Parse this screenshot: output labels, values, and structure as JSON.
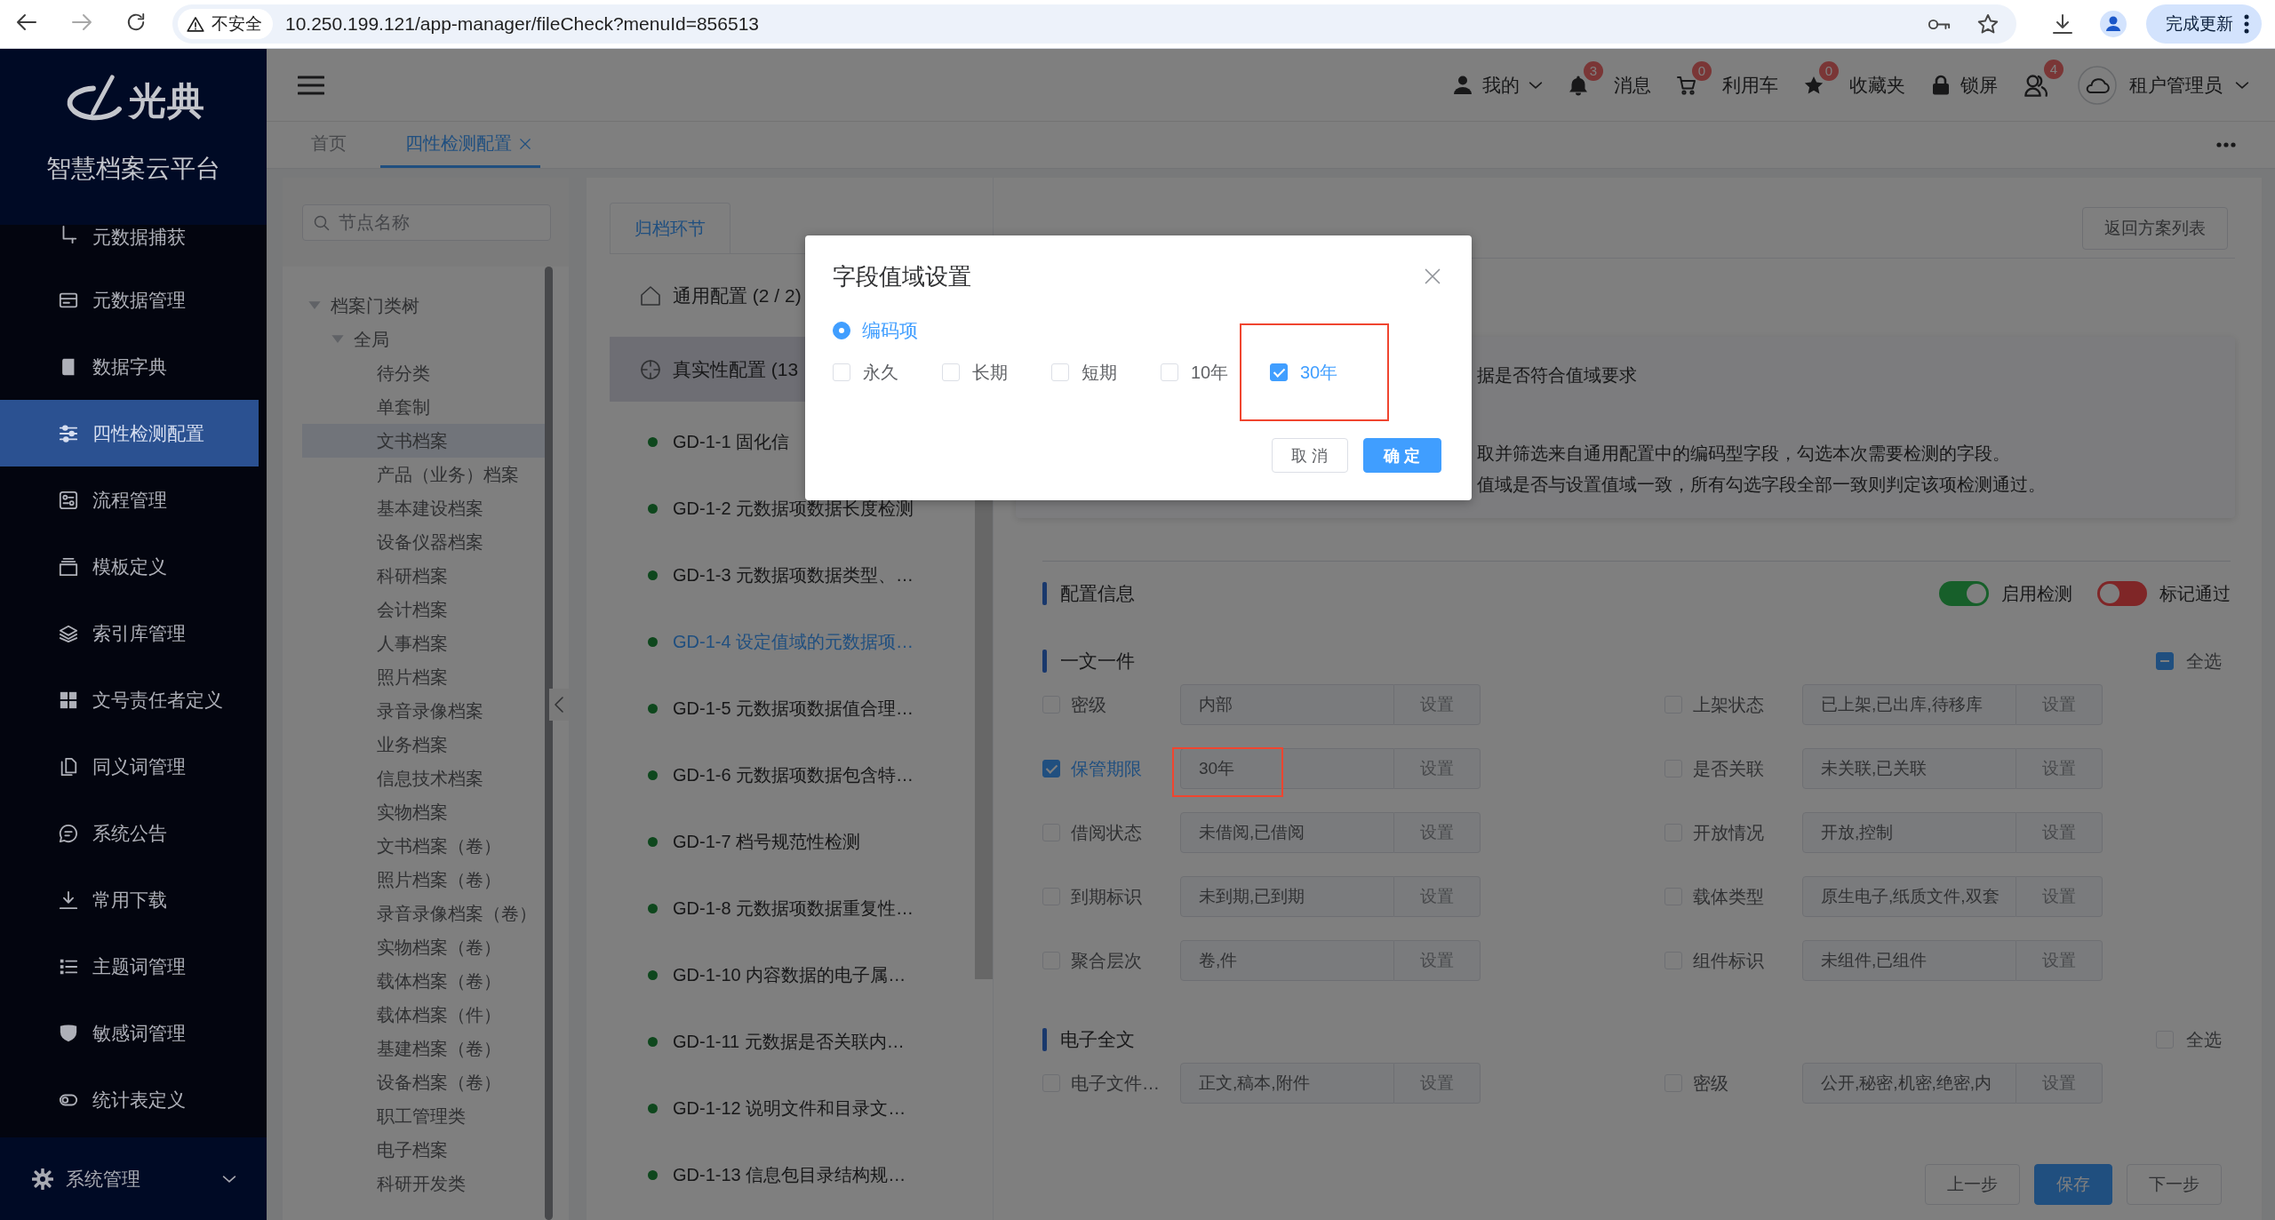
{
  "browser": {
    "security_label": "不安全",
    "url": "10.250.199.121/app-manager/fileCheck?menuId=856513",
    "update_button": "完成更新"
  },
  "sidebar": {
    "logo_text": "光典",
    "platform_name": "智慧档案云平台",
    "items": [
      {
        "label": "元数据捕获",
        "selected": false
      },
      {
        "label": "元数据管理",
        "selected": false
      },
      {
        "label": "数据字典",
        "selected": false
      },
      {
        "label": "四性检测配置",
        "selected": true
      },
      {
        "label": "流程管理",
        "selected": false
      },
      {
        "label": "模板定义",
        "selected": false
      },
      {
        "label": "索引库管理",
        "selected": false
      },
      {
        "label": "文号责任者定义",
        "selected": false
      },
      {
        "label": "同义词管理",
        "selected": false
      },
      {
        "label": "系统公告",
        "selected": false
      },
      {
        "label": "常用下载",
        "selected": false
      },
      {
        "label": "主题词管理",
        "selected": false
      },
      {
        "label": "敏感词管理",
        "selected": false
      },
      {
        "label": "统计表定义",
        "selected": false
      }
    ],
    "footer_menu": {
      "label": "系统管理",
      "expanded": false
    }
  },
  "header": {
    "items": [
      {
        "kind": "user",
        "label": "我的"
      },
      {
        "kind": "bell",
        "badge": "3",
        "label": "消息"
      },
      {
        "kind": "cart",
        "badge": "0",
        "label": "利用车"
      },
      {
        "kind": "star",
        "badge": "0",
        "label": "收藏夹"
      },
      {
        "kind": "lock",
        "label": "锁屏"
      },
      {
        "kind": "users",
        "badge": "4"
      }
    ],
    "account": "租户管理员"
  },
  "tabs": [
    {
      "label": "首页",
      "selected": false
    },
    {
      "label": "四性检测配置",
      "selected": true
    }
  ],
  "tree": {
    "placeholder": "节点名称",
    "nodes": [
      {
        "label": "档案门类树",
        "expanded": true,
        "selected": false,
        "children": [
          {
            "label": "全局",
            "expanded": true,
            "selected": false,
            "children": [
              {
                "label": "待分类",
                "selected": false
              },
              {
                "label": "单套制",
                "selected": false
              },
              {
                "label": "文书档案",
                "selected": true
              },
              {
                "label": "产品（业务）档案",
                "selected": false
              },
              {
                "label": "基本建设档案",
                "selected": false
              },
              {
                "label": "设备仪器档案",
                "selected": false
              },
              {
                "label": "科研档案",
                "selected": false
              },
              {
                "label": "会计档案",
                "selected": false
              },
              {
                "label": "人事档案",
                "selected": false
              },
              {
                "label": "照片档案",
                "selected": false
              },
              {
                "label": "录音录像档案",
                "selected": false
              },
              {
                "label": "业务档案",
                "selected": false
              },
              {
                "label": "信息技术档案",
                "selected": false
              },
              {
                "label": "实物档案",
                "selected": false
              },
              {
                "label": "文书档案（卷）",
                "selected": false
              },
              {
                "label": "照片档案（卷）",
                "selected": false
              },
              {
                "label": "录音录像档案（卷）",
                "selected": false
              },
              {
                "label": "实物档案（卷）",
                "selected": false
              },
              {
                "label": "载体档案（卷）",
                "selected": false
              },
              {
                "label": "载体档案（件）",
                "selected": false
              },
              {
                "label": "基建档案（卷）",
                "selected": false
              },
              {
                "label": "设备档案（卷）",
                "selected": false
              },
              {
                "label": "职工管理类",
                "selected": false
              },
              {
                "label": "电子档案",
                "selected": false
              },
              {
                "label": "科研开发类",
                "selected": false
              }
            ]
          }
        ]
      }
    ]
  },
  "stage_tabs": [
    {
      "label": "归档环节",
      "selected": true
    }
  ],
  "config_groups": [
    {
      "kind": "home",
      "label": "通用配置 (2 / 2)",
      "selected": false
    },
    {
      "kind": "target",
      "label": "真实性配置 (13",
      "selected": true
    }
  ],
  "checks": [
    {
      "label": "GD-1-1 固化信",
      "selected": false
    },
    {
      "label": "GD-1-2 元数据项数据长度检测",
      "selected": false
    },
    {
      "label": "GD-1-3 元数据项数据类型、…",
      "selected": false
    },
    {
      "label": "GD-1-4 设定值域的元数据项…",
      "selected": true
    },
    {
      "label": "GD-1-5 元数据项数据值合理…",
      "selected": false
    },
    {
      "label": "GD-1-6 元数据项数据包含特…",
      "selected": false
    },
    {
      "label": "GD-1-7 档号规范性检测",
      "selected": false
    },
    {
      "label": "GD-1-8 元数据项数据重复性…",
      "selected": false
    },
    {
      "label": "GD-1-10 内容数据的电子属…",
      "selected": false
    },
    {
      "label": "GD-1-11 元数据是否关联内…",
      "selected": false
    },
    {
      "label": "GD-1-12 说明文件和目录文…",
      "selected": false
    },
    {
      "label": "GD-1-13 信息包目录结构规…",
      "selected": false
    }
  ],
  "back_button": "返回方案列表",
  "description": [
    "据是否符合值域要求",
    "取并筛选来自通用配置中的编码型字段，勾选本次需要检测的字段。",
    "值域是否与设置值域一致，所有勾选字段全部一致则判定该项检测通过。"
  ],
  "config_info": {
    "title": "配置信息",
    "switches": [
      {
        "label": "启用检测",
        "on": true
      },
      {
        "label": "标记通过",
        "on": false
      }
    ]
  },
  "sections": [
    {
      "title": "一文一件",
      "select_all": {
        "label": "全选",
        "indeterminate": true
      },
      "fields": [
        {
          "label": "密级",
          "checked": false,
          "highlighted": false,
          "value": "内部",
          "button": "设置"
        },
        {
          "label": "上架状态",
          "checked": false,
          "highlighted": false,
          "value": "已上架,已出库,待移库",
          "button": "设置"
        },
        {
          "label": "保管期限",
          "checked": true,
          "highlighted": true,
          "value": "30年",
          "button": "设置"
        },
        {
          "label": "是否关联",
          "checked": false,
          "highlighted": false,
          "value": "未关联,已关联",
          "button": "设置"
        },
        {
          "label": "借阅状态",
          "checked": false,
          "highlighted": false,
          "value": "未借阅,已借阅",
          "button": "设置"
        },
        {
          "label": "开放情况",
          "checked": false,
          "highlighted": false,
          "value": "开放,控制",
          "button": "设置"
        },
        {
          "label": "到期标识",
          "checked": false,
          "highlighted": false,
          "value": "未到期,已到期",
          "button": "设置"
        },
        {
          "label": "载体类型",
          "checked": false,
          "highlighted": false,
          "value": "原生电子,纸质文件,双套",
          "button": "设置"
        },
        {
          "label": "聚合层次",
          "checked": false,
          "highlighted": false,
          "value": "卷,件",
          "button": "设置"
        },
        {
          "label": "组件标识",
          "checked": false,
          "highlighted": false,
          "value": "未组件,已组件",
          "button": "设置"
        }
      ]
    },
    {
      "title": "电子全文",
      "select_all": {
        "label": "全选",
        "indeterminate": false
      },
      "fields": [
        {
          "label": "电子文件…",
          "checked": false,
          "highlighted": false,
          "value": "正文,稿本,附件",
          "button": "设置"
        },
        {
          "label": "密级",
          "checked": false,
          "highlighted": false,
          "value": "公开,秘密,机密,绝密,内",
          "button": "设置"
        }
      ]
    }
  ],
  "footer_buttons": [
    {
      "label": "上一步",
      "kind": "default"
    },
    {
      "label": "保存",
      "kind": "primary"
    },
    {
      "label": "下一步",
      "kind": "default"
    }
  ],
  "dialog": {
    "title": "字段值域设置",
    "source": {
      "label": "编码项",
      "selected": true
    },
    "options": [
      {
        "label": "永久",
        "checked": false,
        "highlighted": false
      },
      {
        "label": "长期",
        "checked": false,
        "highlighted": false
      },
      {
        "label": "短期",
        "checked": false,
        "highlighted": false
      },
      {
        "label": "10年",
        "checked": false,
        "highlighted": false
      },
      {
        "label": "30年",
        "checked": true,
        "highlighted": true
      }
    ],
    "buttons": [
      {
        "label": "取 消",
        "kind": "default"
      },
      {
        "label": "确 定",
        "kind": "primary"
      }
    ]
  }
}
